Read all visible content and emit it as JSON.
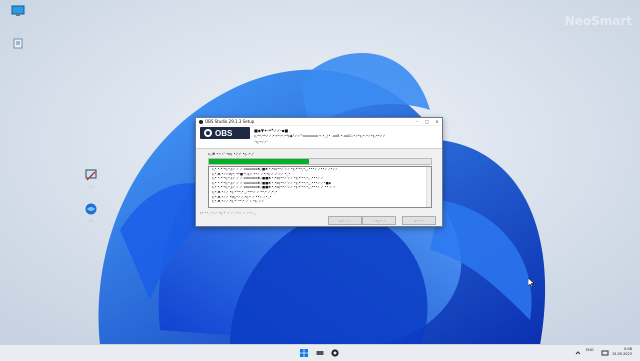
{
  "desktop": {
    "watermark": "NeoSmart",
    "icons": [
      {
        "name": "this-pc-icon",
        "label": ""
      },
      {
        "name": "recycle-bin-icon",
        "label": ""
      },
      {
        "name": "shortcut-icon-1",
        "label": "..."
      },
      {
        "name": "shortcut-icon-2",
        "label": "..."
      }
    ]
  },
  "window": {
    "title": "OBS Studio 29.1.3 Setup",
    "caption_buttons": [
      "–",
      "□",
      "✕"
    ],
    "logo_text": "OBS",
    "header_title": "■◆▼✦·•*✓✓·▪■",
    "header_subtitle": "ç,•*,•*✓✓,•+•:•,•*ç◆°✓✓°'ooooooo •.•,_!• .ooB •.ooD..•✓*ç,•.•✓*ç,•*✓✓",
    "header_subtitle2": "·'ç,•✓✓·",
    "status_text": "ç,,✖ •✓✓' •oç •✓✓ •ç..•,;'",
    "progress_percent": 45,
    "log_lines": [
      "ç,• •.•'•ç,•,ç✓ ✓ ✓ ooooooo✖,:■✖ •,•oç••✓'✓✓ •ç,•'••,•,_.•••✓ ✓••✓ ✓•✓✓",
      "ç,•,✖,•✓✓oç•,  ••■ •,:ç✓ ••✓ ✓•;•ç ✓ ✓'✓✓ •,,•",
      "ç,• •.•'•ç,•,ç✓ ✓ ✓ ooooooo✖,:■■✖ •,•oç••✓'✓✓ •ç,•'••,•,_.•••✓ ✓",
      "ç,• •.•'•ç,•,ç✓ ✓ ✓ ooooooo✖,:■■✖ •,•oç••✓'✓✓ •ç,•'••,•,_.•••✓ ✓•■◆",
      "ç,• •.•'•ç,•,ç✓ ✓ ✓ ooooooo✖,:■■✖ •,•oç••✓'✓✓ •ç,•'••,•,_.•••✓ ✓ •• ✓ ✓",
      "ç,•,✖,•✓✓ •ç,•'••,•,_.•••✓ ✓ ••,• ✓,•',•",
      "ç,•,✖,•✓✓ •oç,•✓✓,•ç,• ✓ ••✓ ✓•,,•",
      "ç,•,✖,•✓✓ •ç,•' ••,• ✓ ✓ •ç, ✓✓"
    ],
    "footer_text": "ç• •• ,•✓✓ •ç,•' ✓ ✓ ✓•✓ ✓ ✓•✓,,",
    "buttons": {
      "back": "‹ç,• ✓✓",
      "next": "·✓•ç,• ✓",
      "cancel": "ç,•✓•"
    }
  },
  "taskbar": {
    "tray_lang": "ENG",
    "time": "0:08",
    "date": "15.05.2023"
  },
  "colors": {
    "accent": "#0067c0",
    "progress": "#06b025",
    "wallpaper_bg": "#d4dde8",
    "bloom_dark": "#0a3cc4",
    "bloom_light": "#3b8cf2"
  }
}
